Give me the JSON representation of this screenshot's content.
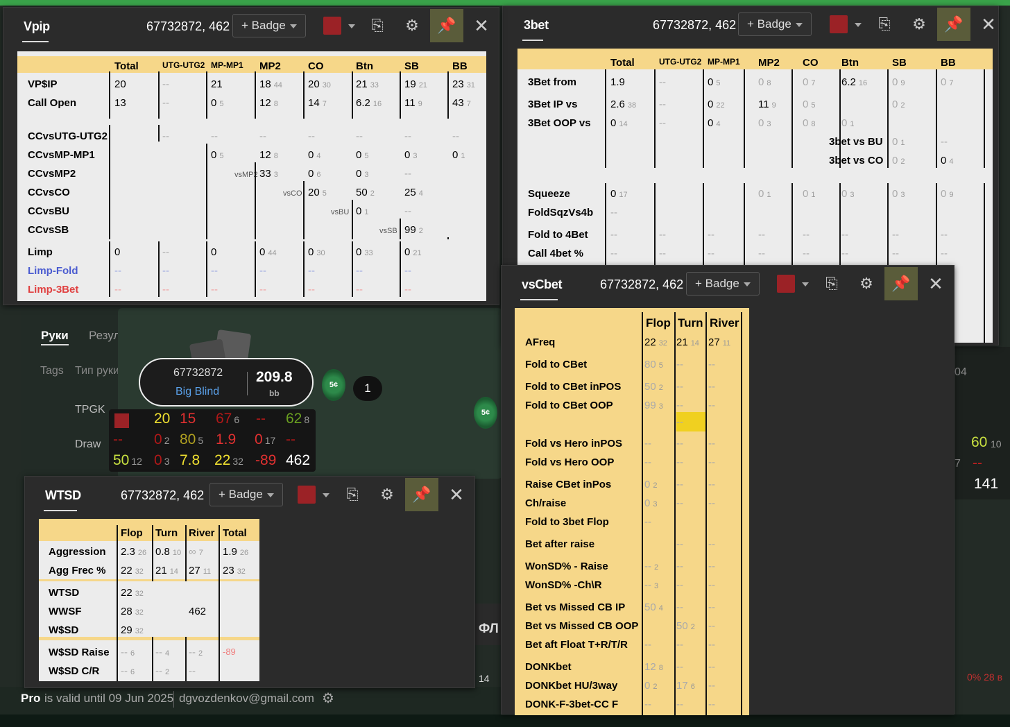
{
  "vpip": {
    "title": "Vpip",
    "player": "67732872, 462",
    "badge": "+ Badge",
    "cols": [
      "Total",
      "UTG-UTG2",
      "MP-MP1",
      "MP2",
      "CO",
      "Btn",
      "SB",
      "BB"
    ],
    "rows": [
      {
        "label": "VP$IP",
        "cells": [
          [
            "20",
            ""
          ],
          [
            "--",
            ""
          ],
          [
            "21",
            ""
          ],
          [
            "18",
            "44"
          ],
          [
            "20",
            "30"
          ],
          [
            "21",
            "33"
          ],
          [
            "19",
            "21"
          ],
          [
            "23",
            "31"
          ]
        ]
      },
      {
        "label": "Call Open",
        "cells": [
          [
            "13",
            ""
          ],
          [
            "--",
            ""
          ],
          [
            "0",
            "5"
          ],
          [
            "12",
            "8"
          ],
          [
            "14",
            "7"
          ],
          [
            "6.2",
            "16"
          ],
          [
            "11",
            "9"
          ],
          [
            "43",
            "7"
          ]
        ]
      }
    ],
    "cc": [
      {
        "label": "CCvsUTG-UTG2",
        "cells": [
          "--",
          "--",
          "--",
          "--",
          "--",
          "--",
          "--"
        ]
      },
      {
        "label": "CCvsMP-MP1",
        "cells": [
          "0",
          "12",
          "0",
          "0",
          "0",
          "0"
        ],
        "subs": [
          "5",
          "8",
          "4",
          "5",
          "3",
          "1"
        ]
      },
      {
        "label": "CCvsMP2",
        "tag": "vsMP2",
        "cells": [
          "33",
          "0",
          "0",
          "--"
        ],
        "subs": [
          "3",
          "6",
          "3",
          ""
        ]
      },
      {
        "label": "CCvsCO",
        "tag": "vsCO",
        "cells": [
          "20",
          "50",
          "25"
        ],
        "subs": [
          "5",
          "2",
          "4"
        ]
      },
      {
        "label": "CCvsBU",
        "tag": "vsBU",
        "cells": [
          "0",
          "--"
        ],
        "subs": [
          "1",
          ""
        ]
      },
      {
        "label": "CCvsSB",
        "tag": "vsSB",
        "cells": [
          "99"
        ],
        "subs": [
          "2"
        ]
      }
    ],
    "limp": [
      {
        "label": "Limp",
        "color": "#000",
        "cells": [
          [
            "0",
            ""
          ],
          [
            "--",
            ""
          ],
          [
            "0",
            ""
          ],
          [
            "0",
            "44"
          ],
          [
            "0",
            "30"
          ],
          [
            "0",
            "33"
          ],
          [
            "0",
            "21"
          ]
        ]
      },
      {
        "label": "Limp-Fold",
        "color": "#4a5bd0",
        "cells": [
          "--",
          "--",
          "--",
          "--",
          "--",
          "--",
          "--"
        ]
      },
      {
        "label": "Limp-3Bet",
        "color": "#e04040",
        "cells": [
          "--",
          "--",
          "--",
          "--",
          "--",
          "--",
          "--"
        ]
      }
    ]
  },
  "threebet": {
    "title": "3bet",
    "player": "67732872, 462",
    "badge": "+ Badge",
    "cols": [
      "Total",
      "UTG-UTG2",
      "MP-MP1",
      "MP2",
      "CO",
      "Btn",
      "SB",
      "BB"
    ],
    "rows": [
      {
        "label": "3Bet from",
        "cells": [
          [
            "1.9",
            ""
          ],
          [
            "--",
            ""
          ],
          [
            "0",
            "5"
          ],
          [
            "0",
            "8"
          ],
          [
            "0",
            "7"
          ],
          [
            "6.2",
            "16"
          ],
          [
            "0",
            "9"
          ],
          [
            "0",
            "7"
          ]
        ]
      },
      {
        "label": "3Bet IP vs",
        "cells": [
          [
            "2.6",
            "38"
          ],
          [
            "--",
            ""
          ],
          [
            "0",
            "22"
          ],
          [
            "11",
            "9"
          ],
          [
            "0",
            "5"
          ],
          [
            "",
            ""
          ],
          [
            "0",
            "2"
          ],
          [
            "",
            ""
          ]
        ]
      },
      {
        "label": "3Bet OOP vs",
        "cells": [
          [
            "0",
            "14"
          ],
          [
            "--",
            ""
          ],
          [
            "0",
            "4"
          ],
          [
            "0",
            "3"
          ],
          [
            "0",
            "8"
          ],
          [
            "0",
            "1"
          ],
          [
            "",
            ""
          ],
          [
            "",
            ""
          ]
        ]
      }
    ],
    "vs": [
      {
        "label": "3bet vs BU",
        "a": [
          "0",
          "1"
        ],
        "b": [
          "--",
          ""
        ]
      },
      {
        "label": "3bet vs CO",
        "a": [
          "0",
          "2"
        ],
        "b": [
          "0",
          "4"
        ]
      }
    ],
    "squeeze": {
      "label": "Squeeze",
      "cells": [
        [
          "0",
          "17"
        ],
        [
          "",
          ""
        ],
        [
          "",
          ""
        ],
        [
          "0",
          "1"
        ],
        [
          "0",
          "1"
        ],
        [
          "0",
          "3"
        ],
        [
          "0",
          "3"
        ],
        [
          "0",
          "9"
        ]
      ]
    },
    "foldsqz": {
      "label": "FoldSqzVs4b",
      "val": "--"
    },
    "fold4": {
      "label": "Fold to 4Bet",
      "cells": [
        "--",
        "--",
        "--",
        "--",
        "--",
        "--",
        "--",
        "--"
      ]
    },
    "call4": {
      "label": "Call 4bet %",
      "cells": [
        "--",
        "--",
        "--",
        "--",
        "--",
        "--",
        "--",
        "--"
      ]
    }
  },
  "vscbet": {
    "title": "vsCbet",
    "player": "67732872, 462",
    "badge": "+ Badge",
    "cols": [
      "Flop",
      "Turn",
      "River"
    ],
    "rows": [
      {
        "label": "AFreq",
        "cells": [
          [
            "22",
            "32"
          ],
          [
            "21",
            "14"
          ],
          [
            "27",
            "11"
          ]
        ],
        "dark": true
      },
      {
        "label": "Fold to CBet",
        "cells": [
          [
            "80",
            "5"
          ],
          [
            "--",
            ""
          ],
          [
            "--",
            ""
          ]
        ]
      },
      {
        "label": "Fold to CBet inPOS",
        "cells": [
          [
            "50",
            "2"
          ],
          [
            "--",
            ""
          ],
          [
            "--",
            ""
          ]
        ]
      },
      {
        "label": "Fold to CBet OOP",
        "cells": [
          [
            "99",
            "3"
          ],
          [
            "--",
            ""
          ],
          [
            "--",
            ""
          ]
        ]
      },
      {
        "label": "",
        "cells": [
          [
            "",
            ""
          ],
          [
            "--",
            ""
          ],
          [
            "",
            ""
          ]
        ]
      },
      {
        "label": "Fold vs Hero inPOS",
        "cells": [
          [
            "--",
            ""
          ],
          [
            "--",
            ""
          ],
          [
            "--",
            ""
          ]
        ]
      },
      {
        "label": "Fold vs Hero OOP",
        "cells": [
          [
            "--",
            ""
          ],
          [
            "--",
            ""
          ],
          [
            "--",
            ""
          ]
        ]
      },
      {
        "label": "Raise CBet inPos",
        "cells": [
          [
            "0",
            "2"
          ],
          [
            "--",
            ""
          ],
          [
            "--",
            ""
          ]
        ]
      },
      {
        "label": "Ch/raise",
        "cells": [
          [
            "0",
            "3"
          ],
          [
            "--",
            ""
          ],
          [
            "--",
            ""
          ]
        ]
      },
      {
        "label": "Fold to 3bet Flop",
        "cells": [
          [
            "--",
            ""
          ],
          [
            "",
            ""
          ],
          [
            "",
            ""
          ]
        ]
      },
      {
        "label": "Bet after raise",
        "cells": [
          [
            "",
            ""
          ],
          [
            "--",
            ""
          ],
          [
            "--",
            ""
          ]
        ]
      },
      {
        "label": "WonSD% - Raise",
        "cells": [
          [
            "--",
            "2"
          ],
          [
            "--",
            ""
          ],
          [
            "--",
            ""
          ]
        ]
      },
      {
        "label": "WonSD% -Ch\\R",
        "cells": [
          [
            "--",
            "3"
          ],
          [
            "--",
            ""
          ],
          [
            "--",
            ""
          ]
        ]
      },
      {
        "label": "Bet vs Missed CB IP",
        "cells": [
          [
            "50",
            "4"
          ],
          [
            "--",
            ""
          ],
          [
            "--",
            ""
          ]
        ]
      },
      {
        "label": "Bet vs Missed CB OOP",
        "cells": [
          [
            "",
            ""
          ],
          [
            "50",
            "2"
          ],
          [
            "--",
            ""
          ]
        ]
      },
      {
        "label": "Bet aft Float T+R/T/R",
        "cells": [
          [
            "--",
            ""
          ],
          [
            "--",
            ""
          ],
          [
            "--",
            ""
          ]
        ]
      },
      {
        "label": "DONKbet",
        "cells": [
          [
            "12",
            "8"
          ],
          [
            "--",
            ""
          ],
          [
            "--",
            ""
          ]
        ]
      },
      {
        "label": "DONKbet HU/3way",
        "cells": [
          [
            "0",
            "2"
          ],
          [
            "17",
            "6"
          ],
          [
            "--",
            ""
          ]
        ]
      },
      {
        "label": "DONK-F-3bet-CC F",
        "cells": [
          [
            "--",
            ""
          ],
          [
            "--",
            ""
          ],
          [
            "--",
            ""
          ]
        ]
      }
    ]
  },
  "wtsd": {
    "title": "WTSD",
    "player": "67732872, 462",
    "badge": "+ Badge",
    "cols": [
      "Flop",
      "Turn",
      "River",
      "Total"
    ],
    "agg": [
      {
        "label": "Aggression",
        "cells": [
          [
            "2.3",
            "26"
          ],
          [
            "0.8",
            "10"
          ],
          [
            "∞",
            "7"
          ],
          [
            "1.9",
            "26"
          ]
        ]
      },
      {
        "label": "Agg Frec %",
        "cells": [
          [
            "22",
            "32"
          ],
          [
            "21",
            "14"
          ],
          [
            "27",
            "11"
          ],
          [
            "23",
            "32"
          ]
        ]
      }
    ],
    "sd": [
      {
        "label": "WTSD",
        "val": "22",
        "sub": "32"
      },
      {
        "label": "WWSF",
        "val": "28",
        "sub": "32"
      },
      {
        "label": "W$SD",
        "val": "29",
        "sub": "32"
      }
    ],
    "hands": "462",
    "raise": [
      {
        "label": "W$SD Raise",
        "cells": [
          [
            "--",
            "6"
          ],
          [
            "--",
            "4"
          ],
          [
            "--",
            "2"
          ],
          [
            "-89",
            ""
          ]
        ]
      },
      {
        "label": "W$SD C/R",
        "cells": [
          [
            "--",
            "6"
          ],
          [
            "--",
            "2"
          ],
          [
            "--",
            ""
          ],
          [
            "",
            ""
          ]
        ]
      }
    ]
  },
  "table": {
    "player_id": "67732872",
    "position": "Big Blind",
    "stack": "209.8",
    "stack_unit": "bb",
    "chip_label": "5¢",
    "chip_count": "1",
    "hud": [
      [
        {
          "v": "20",
          "c": "#f0e030"
        },
        {
          "v": "15",
          "c": "#e03030"
        },
        {
          "v": "67",
          "c": "#b01818",
          "s": "6"
        },
        {
          "v": "--",
          "c": "#b01818"
        },
        {
          "v": "62",
          "c": "#6aa020",
          "s": "8"
        }
      ],
      [
        {
          "v": "--",
          "c": "#b01818"
        },
        {
          "v": "0",
          "c": "#b01818",
          "s": "2"
        },
        {
          "v": "80",
          "c": "#b0a020",
          "s": "5"
        },
        {
          "v": "1.9",
          "c": "#e03030"
        },
        {
          "v": "0",
          "c": "#e03030",
          "s": "17"
        },
        {
          "v": "--",
          "c": "#b01818"
        }
      ],
      [
        {
          "v": "50",
          "c": "#c8e040",
          "s": "12"
        },
        {
          "v": "0",
          "c": "#b01818",
          "s": "3"
        },
        {
          "v": "7.8",
          "c": "#f0e030"
        },
        {
          "v": "22",
          "c": "#f0e030",
          "s": "32"
        },
        {
          "v": "-89",
          "c": "#e03030"
        },
        {
          "v": "462",
          "c": "#ffffff"
        }
      ]
    ],
    "right_hud": {
      "a": "60",
      "a_sub": "10",
      "b": "--",
      "b_pre": "7",
      "c": "141"
    },
    "tabs": [
      "Руки",
      "Резул"
    ],
    "filters": [
      "Tags",
      "Тип руки"
    ],
    "list": [
      "TPGK",
      "Draw",
      "TPGK"
    ],
    "fl": "ФЛ",
    "num14": "14",
    "right04": "04",
    "right_bottom": "0% 28 в"
  },
  "footer": {
    "pro": "Pro",
    "valid": "is valid until 09 Jun 2025",
    "email": "dgvozdenkov@gmail.com"
  }
}
